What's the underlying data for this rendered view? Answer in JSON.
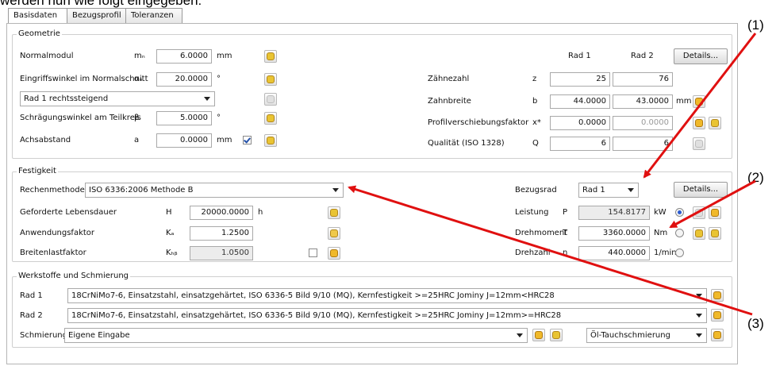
{
  "intro_text": "werden nun wie folgt eingegeben:",
  "tabs": [
    "Basisdaten",
    "Bezugsprofil",
    "Toleranzen"
  ],
  "geometrie": {
    "title": "Geometrie",
    "col_rad1": "Rad 1",
    "col_rad2": "Rad 2",
    "details_label": "Details...",
    "normalmodul": {
      "label": "Normalmodul",
      "sym": "mₙ",
      "value": "6.0000",
      "unit": "mm"
    },
    "eingriffswinkel": {
      "label": "Eingriffswinkel im Normalschnitt",
      "sym": "αₙ",
      "value": "20.0000",
      "unit": "°"
    },
    "schraegung_combo": "Rad 1 rechtssteigend",
    "schraegungswinkel": {
      "label": "Schrägungswinkel am Teilkreis",
      "sym": "β",
      "value": "5.0000",
      "unit": "°"
    },
    "achsabstand": {
      "label": "Achsabstand",
      "sym": "a",
      "value": "0.0000",
      "unit": "mm"
    },
    "zaehnezahl": {
      "label": "Zähnezahl",
      "sym": "z",
      "rad1": "25",
      "rad2": "76"
    },
    "zahnbreite": {
      "label": "Zahnbreite",
      "sym": "b",
      "rad1": "44.0000",
      "rad2": "43.0000",
      "unit": "mm"
    },
    "profilverschiebung": {
      "label": "Profilverschiebungsfaktor",
      "sym": "x*",
      "rad1": "0.0000",
      "rad2": "0.0000"
    },
    "qualitaet": {
      "label": "Qualität (ISO 1328)",
      "sym": "Q",
      "rad1": "6",
      "rad2": "6"
    }
  },
  "festigkeit": {
    "title": "Festigkeit",
    "rechenmethode_label": "Rechenmethode",
    "rechenmethode_value": "ISO 6336:2006 Methode B",
    "lebensdauer": {
      "label": "Geforderte Lebensdauer",
      "sym": "H",
      "value": "20000.0000",
      "unit": "h"
    },
    "anwendungsfaktor": {
      "label": "Anwendungsfaktor",
      "sym": "Kₐ",
      "value": "1.2500"
    },
    "breitenlastfaktor": {
      "label": "Breitenlastfaktor",
      "sym": "Kₕᵦ",
      "value": "1.0500"
    },
    "bezugsrad_label": "Bezugsrad",
    "bezugsrad_value": "Rad 1",
    "details_label": "Details...",
    "leistung": {
      "label": "Leistung",
      "sym": "P",
      "value": "154.8177",
      "unit": "kW"
    },
    "drehmoment": {
      "label": "Drehmoment",
      "sym": "T",
      "value": "3360.0000",
      "unit": "Nm"
    },
    "drehzahl": {
      "label": "Drehzahl",
      "sym": "n",
      "value": "440.0000",
      "unit": "1/min"
    }
  },
  "werkstoffe": {
    "title": "Werkstoffe und Schmierung",
    "rad1_label": "Rad 1",
    "rad1_value": "18CrNiMo7-6, Einsatzstahl, einsatzgehärtet, ISO 6336-5 Bild 9/10 (MQ), Kernfestigkeit >=25HRC Jominy J=12mm<HRC28",
    "rad2_label": "Rad 2",
    "rad2_value": "18CrNiMo7-6, Einsatzstahl, einsatzgehärtet, ISO 6336-5 Bild 9/10 (MQ), Kernfestigkeit >=25HRC Jominy J=12mm>=HRC28",
    "schmierung_label": "Schmierung",
    "schmierung_value": "Eigene Eingabe",
    "schmierart_value": "Öl-Tauchschmierung"
  },
  "callouts": [
    "(1)",
    "(2)",
    "(3)"
  ],
  "colors": {
    "arrow": "#e01010",
    "accent": "#2a5bd0"
  }
}
